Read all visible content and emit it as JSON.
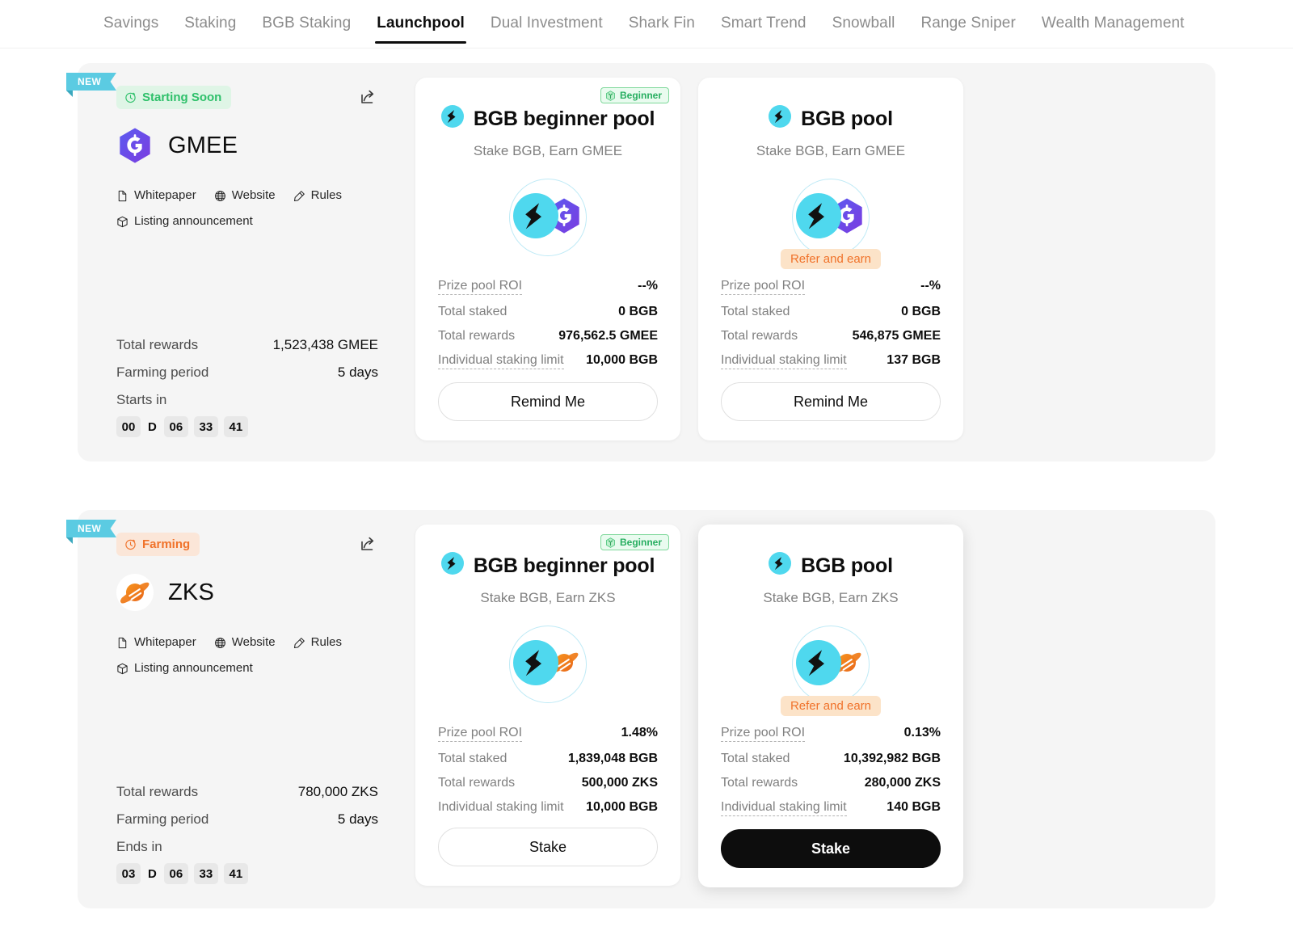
{
  "nav": {
    "tabs": [
      {
        "label": "Savings",
        "active": false
      },
      {
        "label": "Staking",
        "active": false
      },
      {
        "label": "BGB Staking",
        "active": false
      },
      {
        "label": "Launchpool",
        "active": true
      },
      {
        "label": "Dual Investment",
        "active": false
      },
      {
        "label": "Shark Fin",
        "active": false
      },
      {
        "label": "Smart Trend",
        "active": false
      },
      {
        "label": "Snowball",
        "active": false
      },
      {
        "label": "Range Sniper",
        "active": false
      },
      {
        "label": "Wealth Management",
        "active": false
      }
    ]
  },
  "colors": {
    "ribbon": "#5bcbe2",
    "bgb_cyan": "#4fd8ee",
    "status_green": "#2ec06a",
    "status_orange": "#f0722a",
    "beginner_green": "#27ae60",
    "panel_bg": "#f5f5f5"
  },
  "projects": [
    {
      "ribbon": "NEW",
      "status": {
        "label": "Starting Soon",
        "icon": "clock-icon",
        "variant": "soon"
      },
      "share_icon": "share-icon",
      "token": {
        "symbol": "GMEE",
        "logo": "gmee-logo"
      },
      "links": [
        {
          "label": "Whitepaper",
          "icon": "document-icon"
        },
        {
          "label": "Website",
          "icon": "globe-icon"
        },
        {
          "label": "Rules",
          "icon": "pen-icon"
        },
        {
          "label": "Listing announcement",
          "icon": "cube-icon"
        }
      ],
      "stats": [
        {
          "key": "Total rewards",
          "value": "1,523,438 GMEE"
        },
        {
          "key": "Farming period",
          "value": "5 days"
        }
      ],
      "countdown": {
        "label": "Starts in",
        "days": "00",
        "days_unit": "D",
        "hours": "06",
        "minutes": "33",
        "seconds": "41"
      },
      "pools": [
        {
          "badge": {
            "label": "Beginner",
            "icon": "sprout-icon"
          },
          "title": "BGB beginner pool",
          "title_icon": "bgb-logo",
          "subtitle": "Stake BGB, Earn GMEE",
          "art": {
            "left": "bgb-logo",
            "right": "gmee-logo"
          },
          "refer_badge": null,
          "stats": [
            {
              "key": "Prize pool ROI",
              "value": "--%",
              "dotted": true
            },
            {
              "key": "Total staked",
              "value": "0 BGB",
              "dotted": false
            },
            {
              "key": "Total rewards",
              "value": "976,562.5 GMEE",
              "dotted": false
            },
            {
              "key": "Individual staking limit",
              "value": "10,000 BGB",
              "dotted": true
            }
          ],
          "button": {
            "label": "Remind Me",
            "style": "outline"
          },
          "elevated": false
        },
        {
          "badge": null,
          "title": "BGB pool",
          "title_icon": "bgb-logo",
          "subtitle": "Stake BGB, Earn GMEE",
          "art": {
            "left": "bgb-logo",
            "right": "gmee-logo"
          },
          "refer_badge": "Refer and earn",
          "stats": [
            {
              "key": "Prize pool ROI",
              "value": "--%",
              "dotted": true
            },
            {
              "key": "Total staked",
              "value": "0 BGB",
              "dotted": false
            },
            {
              "key": "Total rewards",
              "value": "546,875 GMEE",
              "dotted": false
            },
            {
              "key": "Individual staking limit",
              "value": "137 BGB",
              "dotted": true
            }
          ],
          "button": {
            "label": "Remind Me",
            "style": "outline"
          },
          "elevated": false
        }
      ]
    },
    {
      "ribbon": "NEW",
      "status": {
        "label": "Farming",
        "icon": "clock-icon",
        "variant": "farming"
      },
      "share_icon": "share-icon",
      "token": {
        "symbol": "ZKS",
        "logo": "zks-logo"
      },
      "links": [
        {
          "label": "Whitepaper",
          "icon": "document-icon"
        },
        {
          "label": "Website",
          "icon": "globe-icon"
        },
        {
          "label": "Rules",
          "icon": "pen-icon"
        },
        {
          "label": "Listing announcement",
          "icon": "cube-icon"
        }
      ],
      "stats": [
        {
          "key": "Total rewards",
          "value": "780,000 ZKS"
        },
        {
          "key": "Farming period",
          "value": "5 days"
        }
      ],
      "countdown": {
        "label": "Ends in",
        "days": "03",
        "days_unit": "D",
        "hours": "06",
        "minutes": "33",
        "seconds": "41"
      },
      "pools": [
        {
          "badge": {
            "label": "Beginner",
            "icon": "sprout-icon"
          },
          "title": "BGB beginner pool",
          "title_icon": "bgb-logo",
          "subtitle": "Stake BGB, Earn ZKS",
          "art": {
            "left": "bgb-logo",
            "right": "zks-logo"
          },
          "refer_badge": null,
          "stats": [
            {
              "key": "Prize pool ROI",
              "value": "1.48%",
              "dotted": true
            },
            {
              "key": "Total staked",
              "value": "1,839,048 BGB",
              "dotted": false
            },
            {
              "key": "Total rewards",
              "value": "500,000 ZKS",
              "dotted": false
            },
            {
              "key": "Individual staking limit",
              "value": "10,000 BGB",
              "dotted": false
            }
          ],
          "button": {
            "label": "Stake",
            "style": "outline"
          },
          "elevated": false
        },
        {
          "badge": null,
          "title": "BGB pool",
          "title_icon": "bgb-logo",
          "subtitle": "Stake BGB, Earn ZKS",
          "art": {
            "left": "bgb-logo",
            "right": "zks-logo"
          },
          "refer_badge": "Refer and earn",
          "stats": [
            {
              "key": "Prize pool ROI",
              "value": "0.13%",
              "dotted": true
            },
            {
              "key": "Total staked",
              "value": "10,392,982 BGB",
              "dotted": false
            },
            {
              "key": "Total rewards",
              "value": "280,000 ZKS",
              "dotted": false
            },
            {
              "key": "Individual staking limit",
              "value": "140 BGB",
              "dotted": true
            }
          ],
          "button": {
            "label": "Stake",
            "style": "filled"
          },
          "elevated": true
        }
      ]
    }
  ]
}
